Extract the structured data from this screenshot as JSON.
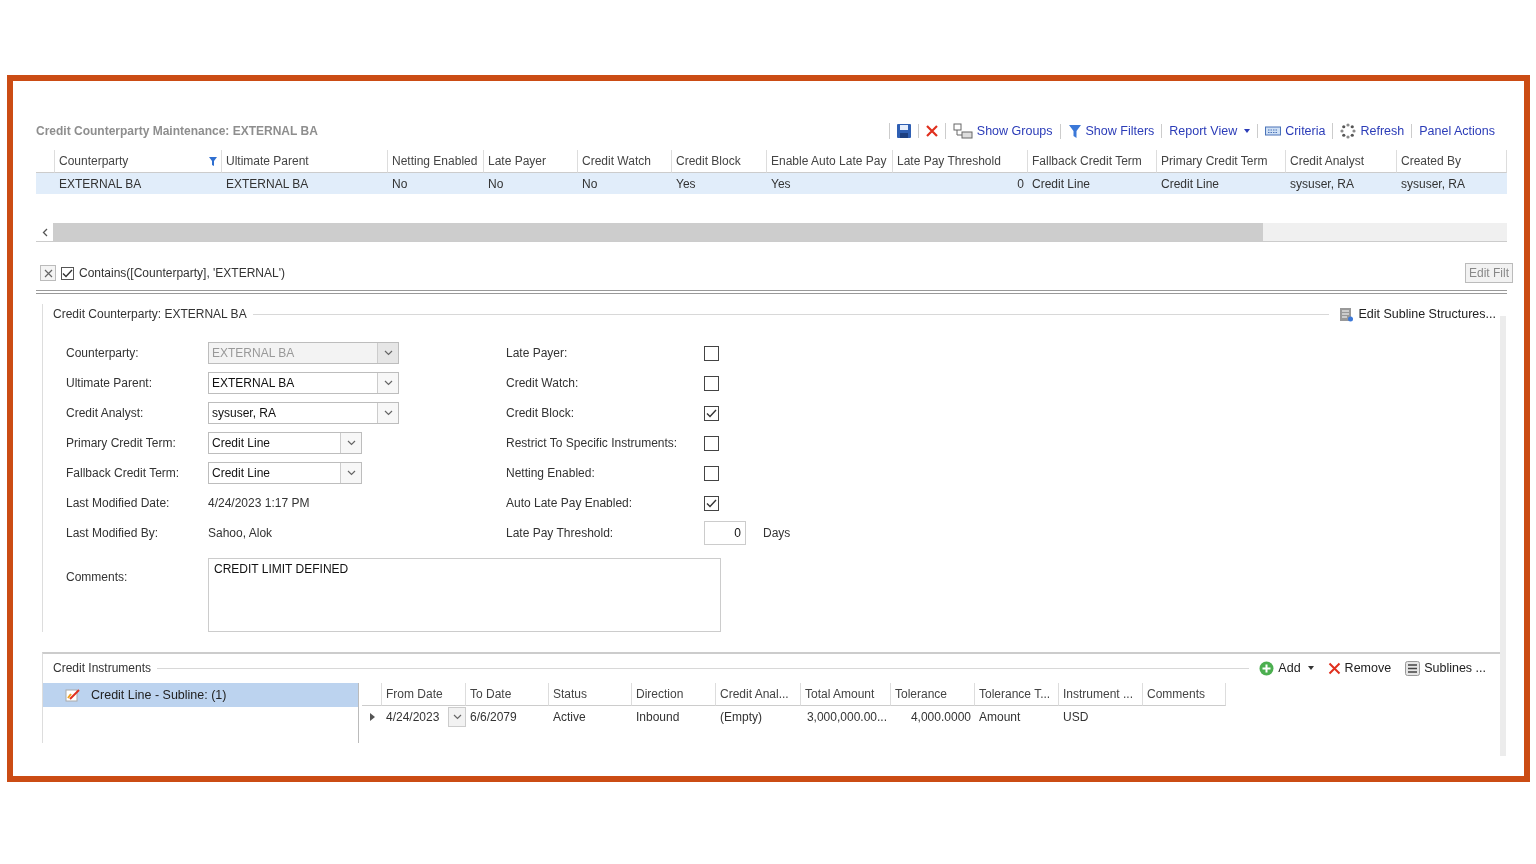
{
  "title": "Credit Counterparty Maintenance: EXTERNAL BA",
  "toolbar": [
    {
      "kind": "save"
    },
    {
      "kind": "delete"
    },
    {
      "kind": "groups",
      "label": "Show Groups"
    },
    {
      "kind": "filter",
      "label": "Show Filters"
    },
    {
      "kind": "dropdown",
      "label": "Report View"
    },
    {
      "kind": "criteria",
      "label": "Criteria"
    },
    {
      "kind": "refresh",
      "label": "Refresh"
    },
    {
      "kind": "text",
      "label": "Panel Actions"
    }
  ],
  "grid": {
    "columns": [
      {
        "label": "Counterparty",
        "filtered": true
      },
      {
        "label": "Ultimate Parent",
        "filtered": false
      },
      {
        "label": "Netting Enabled",
        "filtered": false
      },
      {
        "label": "Late Payer",
        "filtered": false
      },
      {
        "label": "Credit Watch",
        "filtered": false
      },
      {
        "label": "Credit Block",
        "filtered": false
      },
      {
        "label": "Enable Auto Late Pay",
        "filtered": false
      },
      {
        "label": "Late Pay Threshold",
        "filtered": false,
        "numeric": true
      },
      {
        "label": "Fallback Credit Term",
        "filtered": false
      },
      {
        "label": "Primary Credit Term",
        "filtered": false
      },
      {
        "label": "Credit Analyst",
        "filtered": false
      },
      {
        "label": "Created By",
        "filtered": false
      }
    ],
    "rows": [
      {
        "selected": true,
        "cells": [
          "EXTERNAL BA",
          "EXTERNAL BA",
          "No",
          "No",
          "No",
          "Yes",
          "Yes",
          "0",
          "Credit Line",
          "Credit Line",
          "sysuser, RA",
          "sysuser, RA"
        ]
      }
    ]
  },
  "filter_bar": {
    "checked": true,
    "expression": "Contains([Counterparty], 'EXTERNAL')",
    "edit_button": "Edit Filt"
  },
  "details": {
    "title": "Credit Counterparty: EXTERNAL BA",
    "action": "Edit Subline Structures...",
    "left_fields": [
      {
        "label": "Counterparty:",
        "kind": "combo",
        "value": "EXTERNAL BA",
        "disabled": true
      },
      {
        "label": "Ultimate Parent:",
        "kind": "combo",
        "value": "EXTERNAL BA",
        "disabled": false
      },
      {
        "label": "Credit Analyst:",
        "kind": "combo",
        "value": "sysuser, RA",
        "disabled": false
      },
      {
        "label": "Primary Credit Term:",
        "kind": "combo",
        "value": "Credit Line",
        "disabled": false
      },
      {
        "label": "Fallback Credit Term:",
        "kind": "combo",
        "value": "Credit Line",
        "disabled": false
      },
      {
        "label": "Last Modified Date:",
        "kind": "text",
        "value": "4/24/2023 1:17 PM"
      },
      {
        "label": "Last Modified By:",
        "kind": "text",
        "value": "Sahoo, Alok"
      }
    ],
    "right_fields": [
      {
        "label": "Late Payer:",
        "kind": "checkbox",
        "checked": false
      },
      {
        "label": "Credit Watch:",
        "kind": "checkbox",
        "checked": false
      },
      {
        "label": "Credit Block:",
        "kind": "checkbox",
        "checked": true
      },
      {
        "label": "Restrict To Specific Instruments:",
        "kind": "checkbox",
        "checked": false
      },
      {
        "label": "Netting Enabled:",
        "kind": "checkbox",
        "checked": false
      },
      {
        "label": "Auto Late Pay Enabled:",
        "kind": "checkbox",
        "checked": true
      },
      {
        "label": "Late Pay Threshold:",
        "kind": "number",
        "value": "0",
        "unit": "Days"
      }
    ],
    "comments": {
      "label": "Comments:",
      "value": "CREDIT LIMIT DEFINED"
    }
  },
  "instruments": {
    "title": "Credit Instruments",
    "actions": [
      {
        "kind": "add",
        "label": "Add"
      },
      {
        "kind": "remove",
        "label": "Remove"
      },
      {
        "kind": "sublines",
        "label": "Sublines ..."
      }
    ],
    "tree": [
      {
        "label": "Credit Line - Subline: (1)",
        "selected": true
      }
    ],
    "columns": [
      {
        "label": "From Date"
      },
      {
        "label": "To Date"
      },
      {
        "label": "Status"
      },
      {
        "label": "Direction"
      },
      {
        "label": "Credit Anal..."
      },
      {
        "label": "Total Amount",
        "numeric": true
      },
      {
        "label": "Tolerance",
        "numeric": true
      },
      {
        "label": "Tolerance T..."
      },
      {
        "label": "Instrument ..."
      },
      {
        "label": "Comments"
      }
    ],
    "rows": [
      {
        "cells": [
          "4/24/2023",
          "6/6/2079",
          "Active",
          "Inbound",
          "(Empty)",
          "3,000,000.00...",
          "4,000.0000",
          "Amount",
          "USD"
        ]
      }
    ]
  }
}
